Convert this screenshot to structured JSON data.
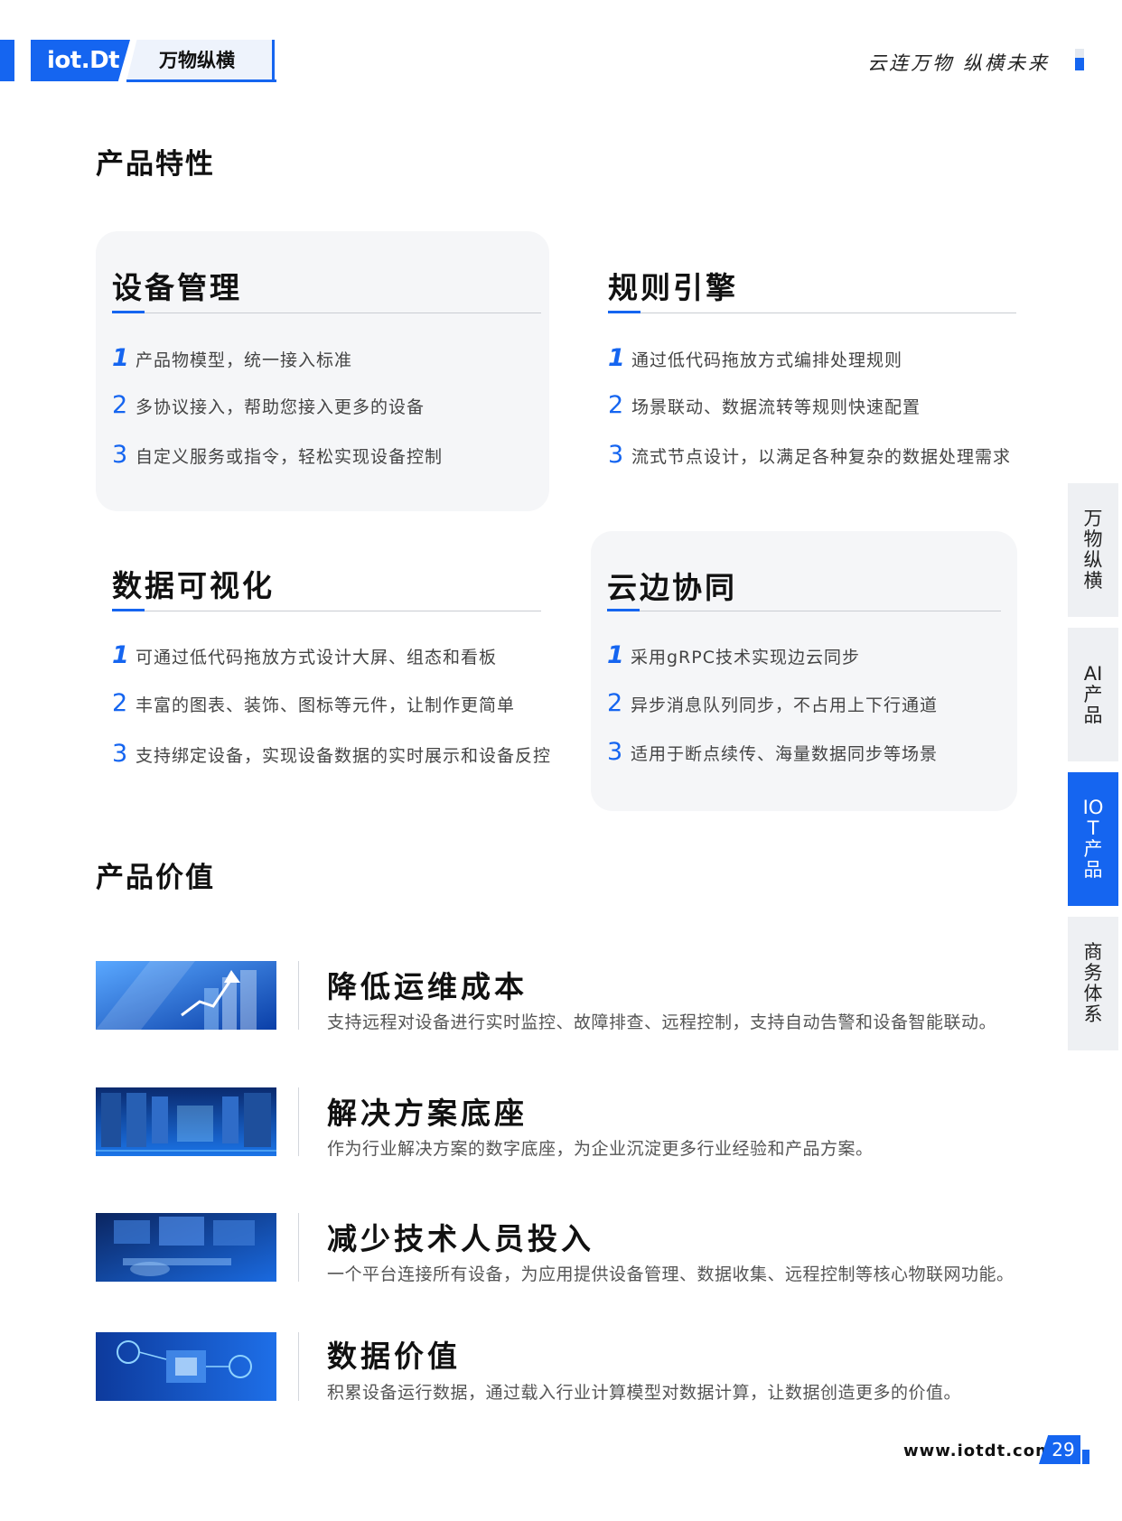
{
  "header": {
    "logo_text": "iot.Dt",
    "brand_name": "万物纵横",
    "slogan": "云连万物 纵横未来"
  },
  "features": {
    "title": "产品特性",
    "cards": [
      {
        "title": "设备管理",
        "items": [
          {
            "num": "1",
            "text": "产品物模型，统一接入标准"
          },
          {
            "num": "2",
            "text": "多协议接入，帮助您接入更多的设备"
          },
          {
            "num": "3",
            "text": "自定义服务或指令，轻松实现设备控制"
          }
        ]
      },
      {
        "title": "规则引擎",
        "items": [
          {
            "num": "1",
            "text": "通过低代码拖放方式编排处理规则"
          },
          {
            "num": "2",
            "text": "场景联动、数据流转等规则快速配置"
          },
          {
            "num": "3",
            "text": "流式节点设计，以满足各种复杂的数据处理需求"
          }
        ]
      },
      {
        "title": "数据可视化",
        "items": [
          {
            "num": "1",
            "text": "可通过低代码拖放方式设计大屏、组态和看板"
          },
          {
            "num": "2",
            "text": "丰富的图表、装饰、图标等元件，让制作更简单"
          },
          {
            "num": "3",
            "text": "支持绑定设备，实现设备数据的实时展示和设备反控"
          }
        ]
      },
      {
        "title": "云边协同",
        "items": [
          {
            "num": "1",
            "text": "采用gRPC技术实现边云同步"
          },
          {
            "num": "2",
            "text": "异步消息队列同步，不占用上下行通道"
          },
          {
            "num": "3",
            "text": "适用于断点续传、海量数据同步等场景"
          }
        ]
      }
    ]
  },
  "values": {
    "title": "产品价值",
    "items": [
      {
        "title": "降低运维成本",
        "desc": "支持远程对设备进行实时监控、故障排查、远程控制，支持自动告警和设备智能联动。"
      },
      {
        "title": "解决方案底座",
        "desc": "作为行业解决方案的数字底座，为企业沉淀更多行业经验和产品方案。"
      },
      {
        "title": "减少技术人员投入",
        "desc": "一个平台连接所有设备，为应用提供设备管理、数据收集、远程控制等核心物联网功能。"
      },
      {
        "title": "数据价值",
        "desc": "积累设备运行数据，通过载入行业计算模型对数据计算，让数据创造更多的价值。"
      }
    ]
  },
  "side_tabs": [
    {
      "label": "万物纵横",
      "active": false
    },
    {
      "label": "AI产品",
      "active": false
    },
    {
      "label": "IOT产品",
      "active": true
    },
    {
      "label": "商务体系",
      "active": false
    }
  ],
  "footer": {
    "website": "www.iotdt.com",
    "page_number": "29"
  },
  "colors": {
    "accent": "#1565f0",
    "card_bg": "#f5f6f8"
  }
}
